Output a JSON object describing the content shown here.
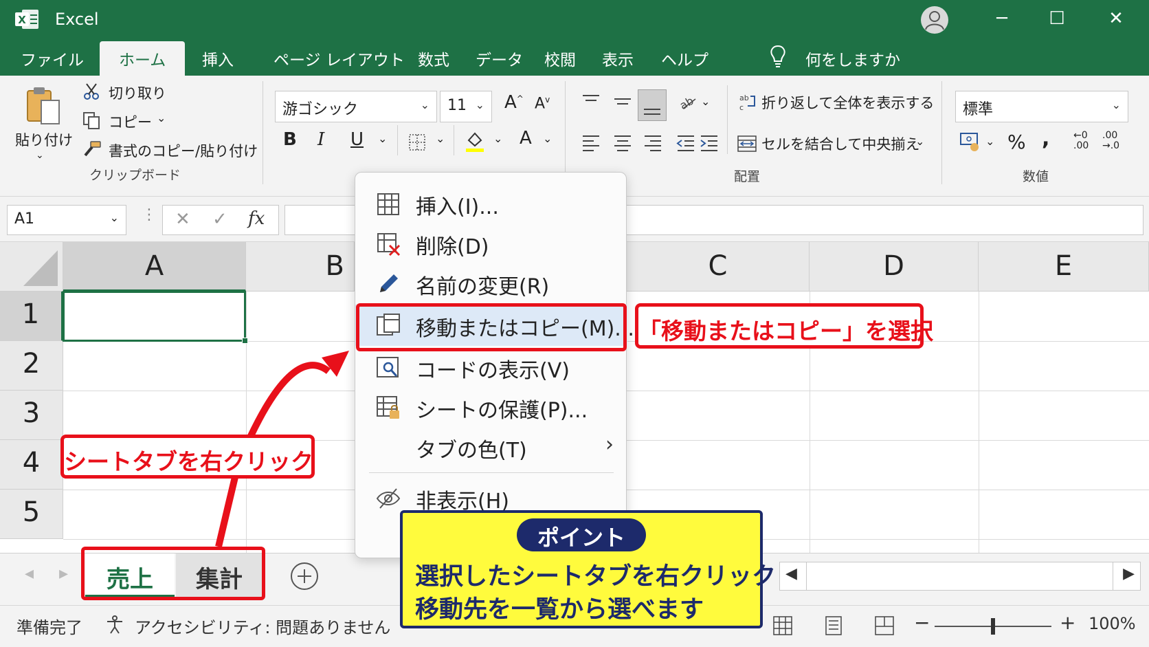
{
  "app": {
    "title": "Excel",
    "window_controls": [
      "minimize-icon",
      "maximize-icon",
      "close-icon"
    ]
  },
  "ribbon_tabs": [
    "ファイル",
    "ホーム",
    "挿入",
    "ページ レイアウト",
    "数式",
    "データ",
    "校閲",
    "表示",
    "ヘルプ"
  ],
  "active_tab": "ホーム",
  "tell_me": "何をしますか",
  "clipboard": {
    "paste": "貼り付け",
    "cut": "切り取り",
    "copy": "コピー",
    "format_painter": "書式のコピー/貼り付け",
    "group": "クリップボード"
  },
  "font": {
    "name": "游ゴシック",
    "size": "11",
    "bold": "B",
    "italic": "I",
    "underline": "U",
    "font_color": "A"
  },
  "alignment": {
    "wrap_text": "折り返して全体を表示する",
    "merge_center": "セルを結合して中央揃え",
    "group": "配置"
  },
  "number": {
    "format": "標準",
    "percent": "%",
    "comma": ",",
    "increase_decimal": "←0 .00",
    "decrease_decimal": ".00 →.0",
    "group": "数値"
  },
  "formula_bar": {
    "name_box": "A1",
    "fx": "fx",
    "value": ""
  },
  "grid": {
    "columns": [
      "A",
      "B",
      "C",
      "D",
      "E"
    ],
    "rows": [
      "1",
      "2",
      "3",
      "4",
      "5"
    ],
    "selected_cell": "A1"
  },
  "sheet_tabs": [
    "売上",
    "集計"
  ],
  "active_sheet": "売上",
  "status": {
    "ready": "準備完了",
    "accessibility": "アクセシビリティ: 問題ありません",
    "zoom": "100%",
    "zoom_level": 0.5
  },
  "context_menu": {
    "items": [
      {
        "label": "挿入(I)...",
        "icon": "insert-sheet-icon"
      },
      {
        "label": "削除(D)",
        "icon": "delete-sheet-icon"
      },
      {
        "label": "名前の変更(R)",
        "icon": "pencil-icon"
      },
      {
        "label": "移動またはコピー(M)...",
        "icon": "move-copy-icon",
        "highlighted": true
      },
      {
        "label": "コードの表示(V)",
        "icon": "view-code-icon"
      },
      {
        "label": "シートの保護(P)...",
        "icon": "protect-sheet-icon"
      },
      {
        "label": "タブの色(T)",
        "icon": "",
        "submenu": true
      },
      {
        "label": "非表示(H)",
        "icon": "hide-eye-icon"
      }
    ]
  },
  "annotations": {
    "right_click_label": "シートタブを右クリック",
    "select_label": "「移動またはコピー」を選択",
    "point_title": "ポイント",
    "point_line1": "選択したシートタブを右クリック",
    "point_line2": "移動先を一覧から選べます"
  },
  "colors": {
    "excel_green": "#1e7145",
    "annotation_red": "#e8101a",
    "point_yellow": "#fffb3d",
    "point_navy": "#1d2a6b"
  }
}
